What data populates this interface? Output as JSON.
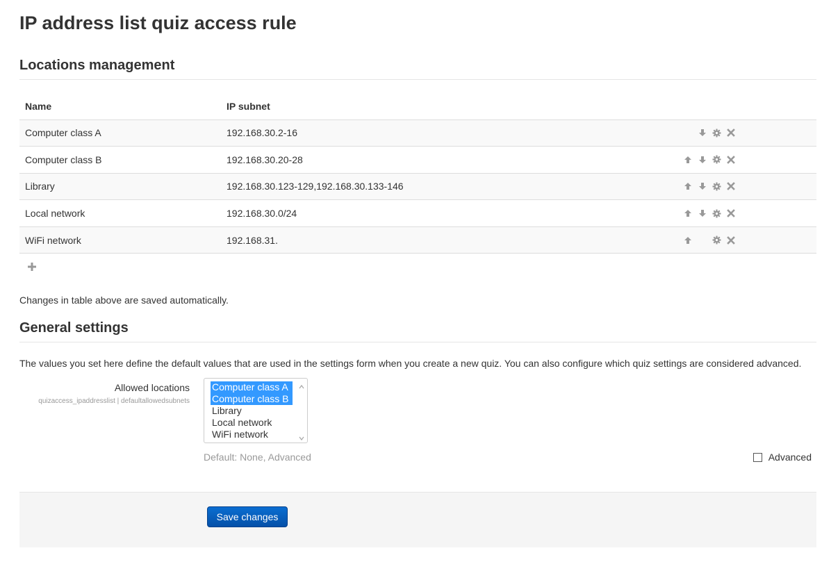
{
  "page_title": "IP address list quiz access rule",
  "locations_section": {
    "heading": "Locations management",
    "columns": [
      "Name",
      "IP subnet"
    ],
    "rows": [
      {
        "name": "Computer class A",
        "subnet": "192.168.30.2-16",
        "icons": [
          "arrow-down-icon",
          "gear-icon",
          "close-icon"
        ]
      },
      {
        "name": "Computer class B",
        "subnet": "192.168.30.20-28",
        "icons": [
          "arrow-up-icon",
          "arrow-down-icon",
          "gear-icon",
          "close-icon"
        ]
      },
      {
        "name": "Library",
        "subnet": "192.168.30.123-129,192.168.30.133-146",
        "icons": [
          "arrow-up-icon",
          "arrow-down-icon",
          "gear-icon",
          "close-icon"
        ]
      },
      {
        "name": "Local network",
        "subnet": "192.168.30.0/24",
        "icons": [
          "arrow-up-icon",
          "arrow-down-icon",
          "gear-icon",
          "close-icon"
        ]
      },
      {
        "name": "WiFi network",
        "subnet": "192.168.31.",
        "icons": [
          "arrow-up-icon",
          "gear-icon",
          "close-icon"
        ]
      }
    ],
    "add_icon": "plus-icon",
    "autosave_note": "Changes in table above are saved automatically."
  },
  "general_section": {
    "heading": "General settings",
    "description": "The values you set here define the default values that are used in the settings form when you create a new quiz. You can also configure which quiz settings are considered advanced.",
    "allowed_locations": {
      "label": "Allowed locations",
      "setting_name": "quizaccess_ipaddresslist | defaultallowedsubnets",
      "options": [
        {
          "label": "Computer class A",
          "selected": true
        },
        {
          "label": "Computer class B",
          "selected": true
        },
        {
          "label": "Library",
          "selected": false
        },
        {
          "label": "Local network",
          "selected": false
        },
        {
          "label": "WiFi network",
          "selected": false
        }
      ],
      "default_note": "Default: None, Advanced",
      "advanced_label": "Advanced",
      "advanced_checked": false
    }
  },
  "footer": {
    "save_label": "Save changes"
  },
  "colors": {
    "selection": "#3399ff",
    "primary_button": "#0a6ed1",
    "icon_gray": "#999999"
  }
}
